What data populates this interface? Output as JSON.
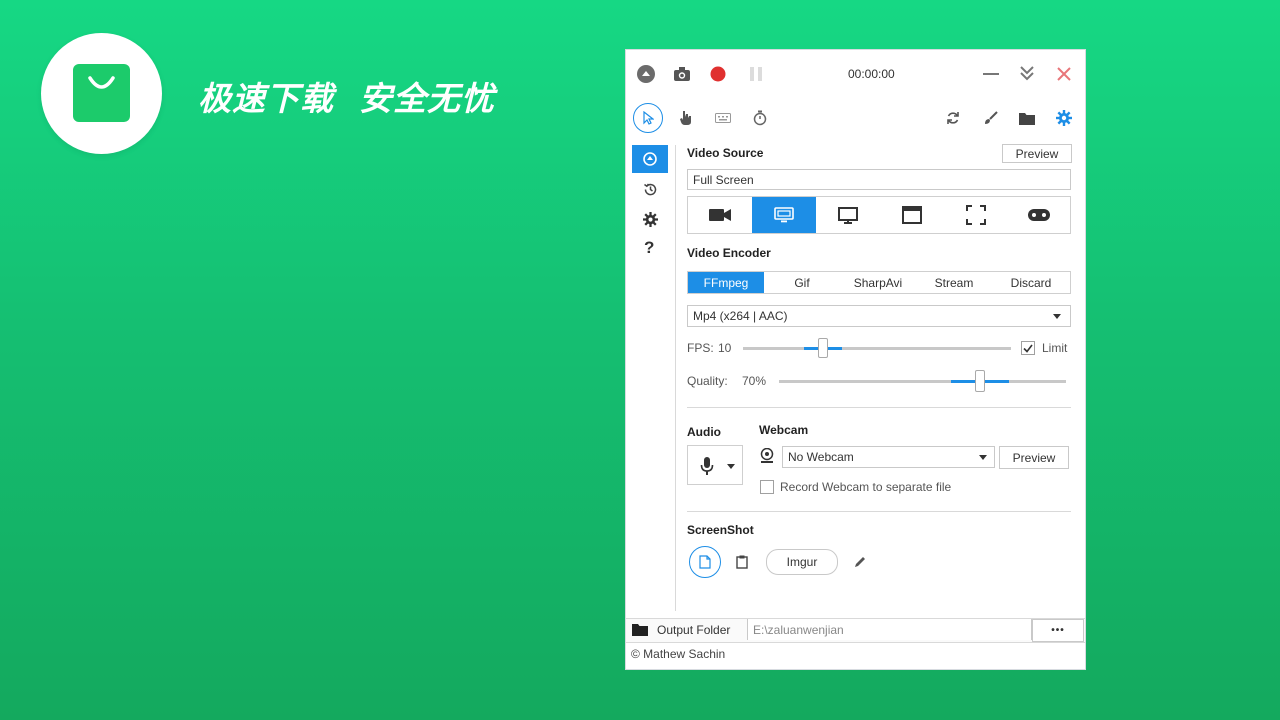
{
  "promo": {
    "slogan": "极速下载  安全无忧",
    "brand_color": "#1ccb6b"
  },
  "titlebar": {
    "timer": "00:00:00",
    "icons": [
      "back-icon",
      "camera-icon",
      "record-icon",
      "pause-icon",
      "minimize-icon",
      "collapse-icon",
      "close-icon"
    ]
  },
  "toolbar": {
    "icons": [
      "pointer-icon",
      "hand-icon",
      "keyboard-icon",
      "timer-icon",
      "refresh-icon",
      "brush-icon",
      "folder-icon",
      "settings-icon"
    ]
  },
  "sidebar": {
    "items": [
      "home-icon",
      "history-icon",
      "settings-icon",
      "help-icon"
    ],
    "help_label": "?"
  },
  "video_source": {
    "title": "Video Source",
    "preview_label": "Preview",
    "value": "Full Screen",
    "sources": [
      "camera-source-icon",
      "screen-source-icon",
      "monitor-source-icon",
      "window-source-icon",
      "region-source-icon",
      "gaming-source-icon"
    ],
    "selected_index": 1
  },
  "video_encoder": {
    "title": "Video Encoder",
    "tabs": [
      "FFmpeg",
      "Gif",
      "SharpAvi",
      "Stream",
      "Discard"
    ],
    "selected_tab": 0,
    "format": "Mp4 (x264 | AAC)",
    "fps_label": "FPS:",
    "fps_value": "10",
    "fps_level": 0.3,
    "limit_label": "Limit",
    "limit_checked": true,
    "quality_label": "Quality:",
    "quality_value": "70%",
    "quality_level": 0.7
  },
  "audio": {
    "title": "Audio"
  },
  "webcam": {
    "title": "Webcam",
    "selected": "No Webcam",
    "preview_label": "Preview",
    "separate_label": "Record Webcam to separate file",
    "separate_checked": false
  },
  "screenshot": {
    "title": "ScreenShot",
    "imgur_label": "Imgur"
  },
  "footer": {
    "output_label": "Output Folder",
    "output_path": "E:\\zaluanwenjian",
    "more_label": "•••",
    "copyright": "© Mathew Sachin"
  },
  "colors": {
    "accent": "#1d8ee6",
    "record": "#e0302f",
    "close": "#e8767a"
  }
}
